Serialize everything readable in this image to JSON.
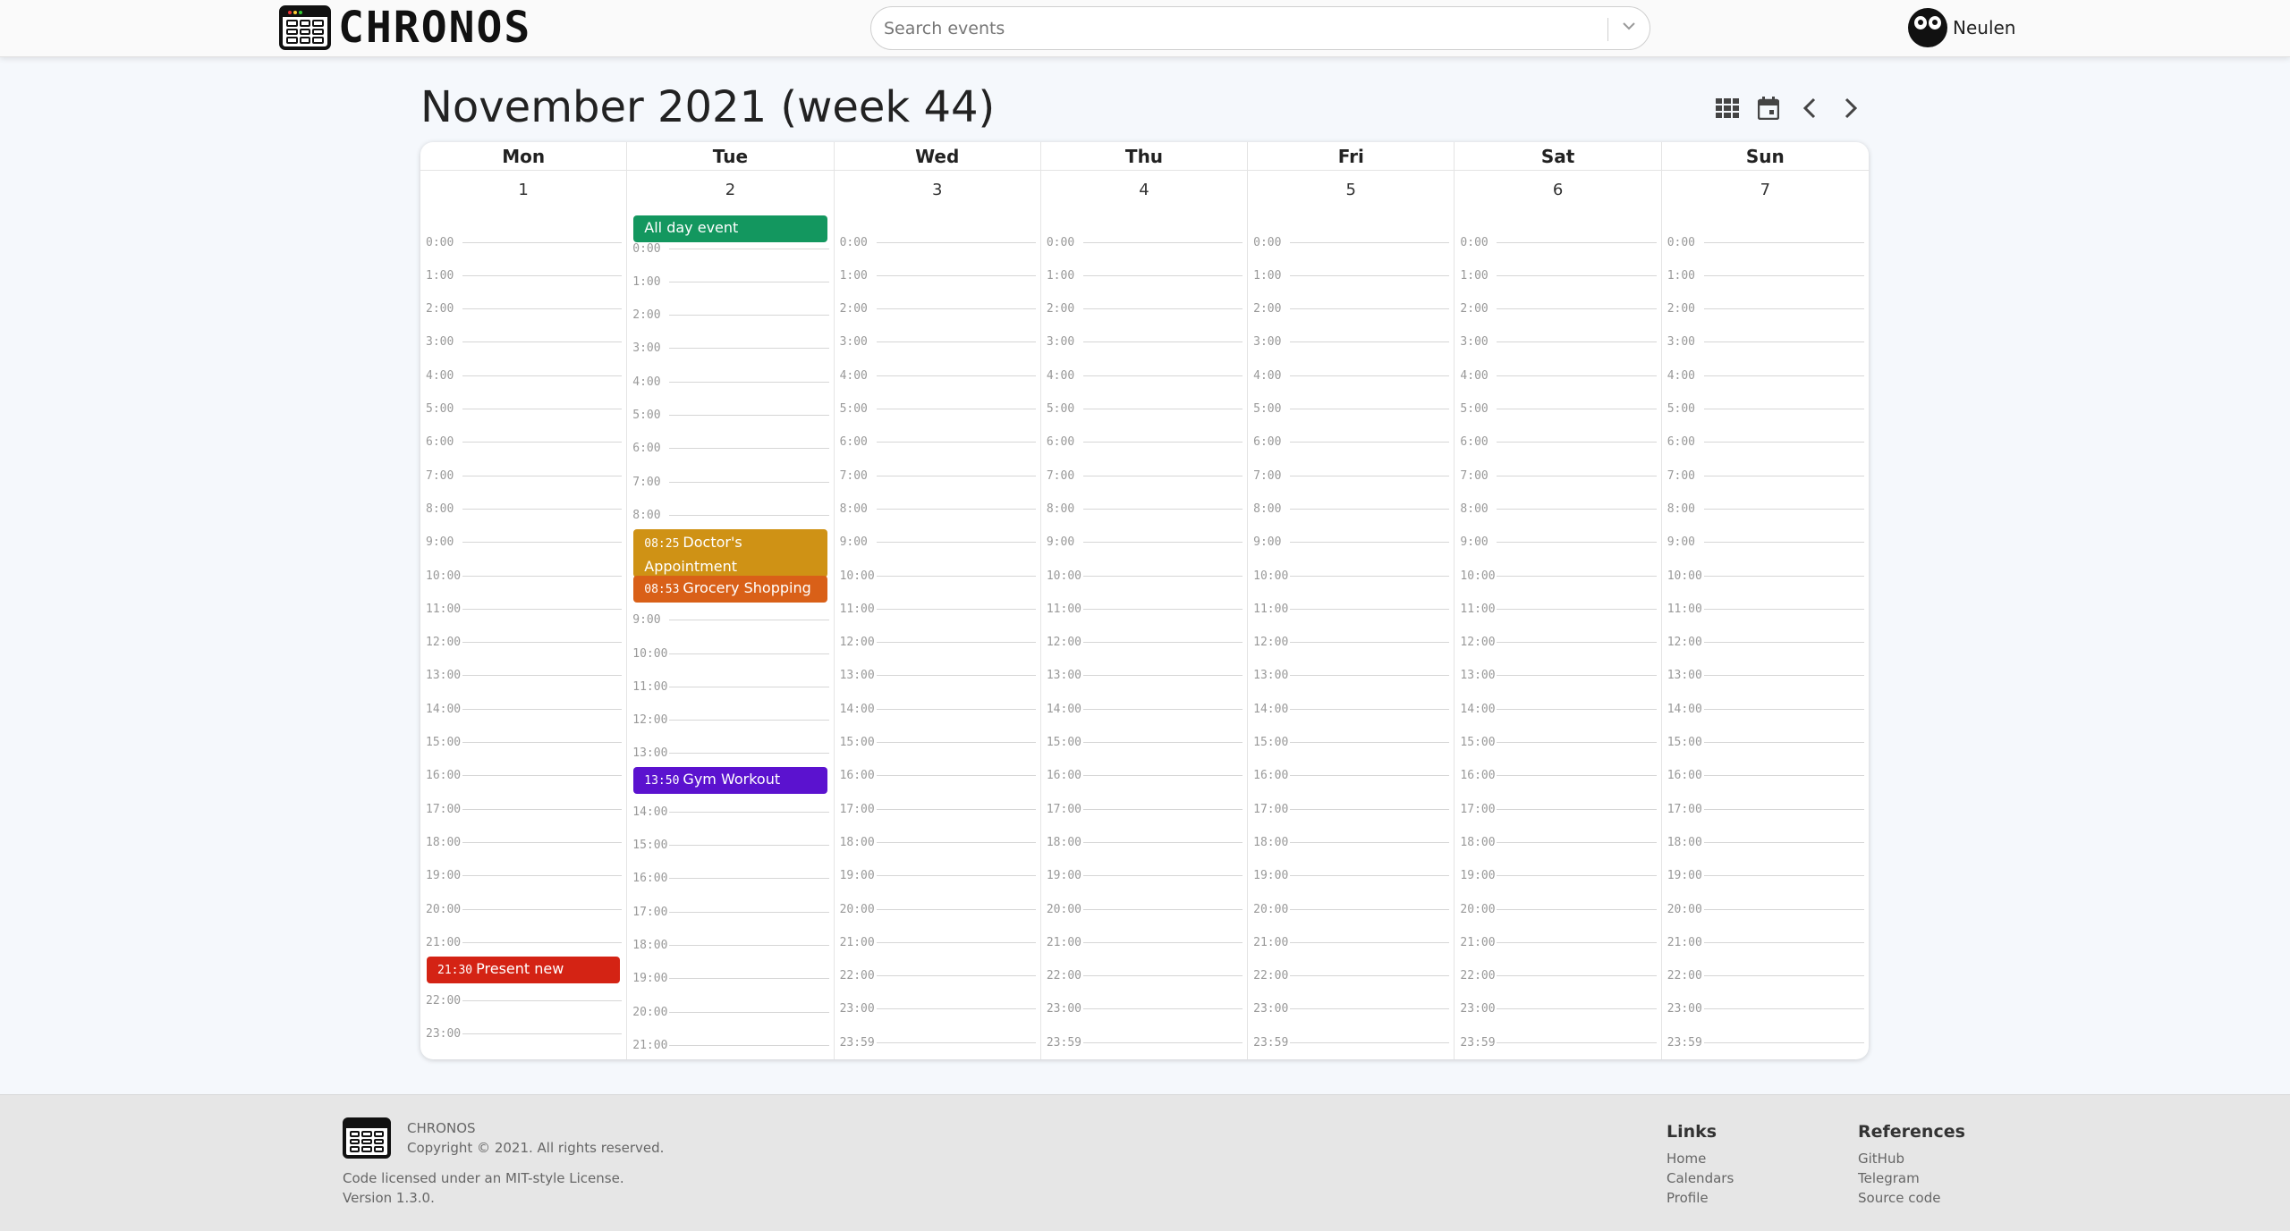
{
  "header": {
    "logo_text": "CHRONOS",
    "search_placeholder": "Search events",
    "user_name": "Neulen"
  },
  "page_title": "November 2021 (week 44)",
  "controls": [
    "grid-view-icon",
    "calendar-icon",
    "chevron-left-icon",
    "chevron-right-icon"
  ],
  "hours": [
    "0:00",
    "1:00",
    "2:00",
    "3:00",
    "4:00",
    "5:00",
    "6:00",
    "7:00",
    "8:00",
    "9:00",
    "10:00",
    "11:00",
    "12:00",
    "13:00",
    "14:00",
    "15:00",
    "16:00",
    "17:00",
    "18:00",
    "19:00",
    "20:00",
    "21:00",
    "22:00",
    "23:00",
    "23:59"
  ],
  "days": [
    {
      "name": "Mon",
      "date": "1",
      "all_day": null,
      "events": [
        {
          "time": "21:30",
          "title": "Present new product",
          "color": "#d42314",
          "after_hour": 21
        }
      ]
    },
    {
      "name": "Tue",
      "date": "2",
      "all_day": {
        "title": "All day event",
        "color": "#13975f"
      },
      "events": [
        {
          "time": "08:25",
          "title": "Doctor's Appointment",
          "color": "#cf9215",
          "after_hour": 8
        },
        {
          "time": "08:53",
          "title": "Grocery Shopping",
          "color": "#d96018",
          "after_hour": 8
        },
        {
          "time": "13:50",
          "title": "Gym Workout",
          "color": "#5b12cf",
          "after_hour": 13
        }
      ]
    },
    {
      "name": "Wed",
      "date": "3",
      "all_day": null,
      "events": []
    },
    {
      "name": "Thu",
      "date": "4",
      "all_day": null,
      "events": []
    },
    {
      "name": "Fri",
      "date": "5",
      "all_day": null,
      "events": []
    },
    {
      "name": "Sat",
      "date": "6",
      "all_day": null,
      "events": []
    },
    {
      "name": "Sun",
      "date": "7",
      "all_day": null,
      "events": []
    }
  ],
  "footer": {
    "brand": "CHRONOS",
    "copyright": "Copyright © 2021. All rights reserved.",
    "license": "Code licensed under an MIT-style License.",
    "version": "Version 1.3.0.",
    "links_title": "Links",
    "links": [
      "Home",
      "Calendars",
      "Profile"
    ],
    "references_title": "References",
    "references": [
      "GitHub",
      "Telegram",
      "Source code"
    ]
  }
}
